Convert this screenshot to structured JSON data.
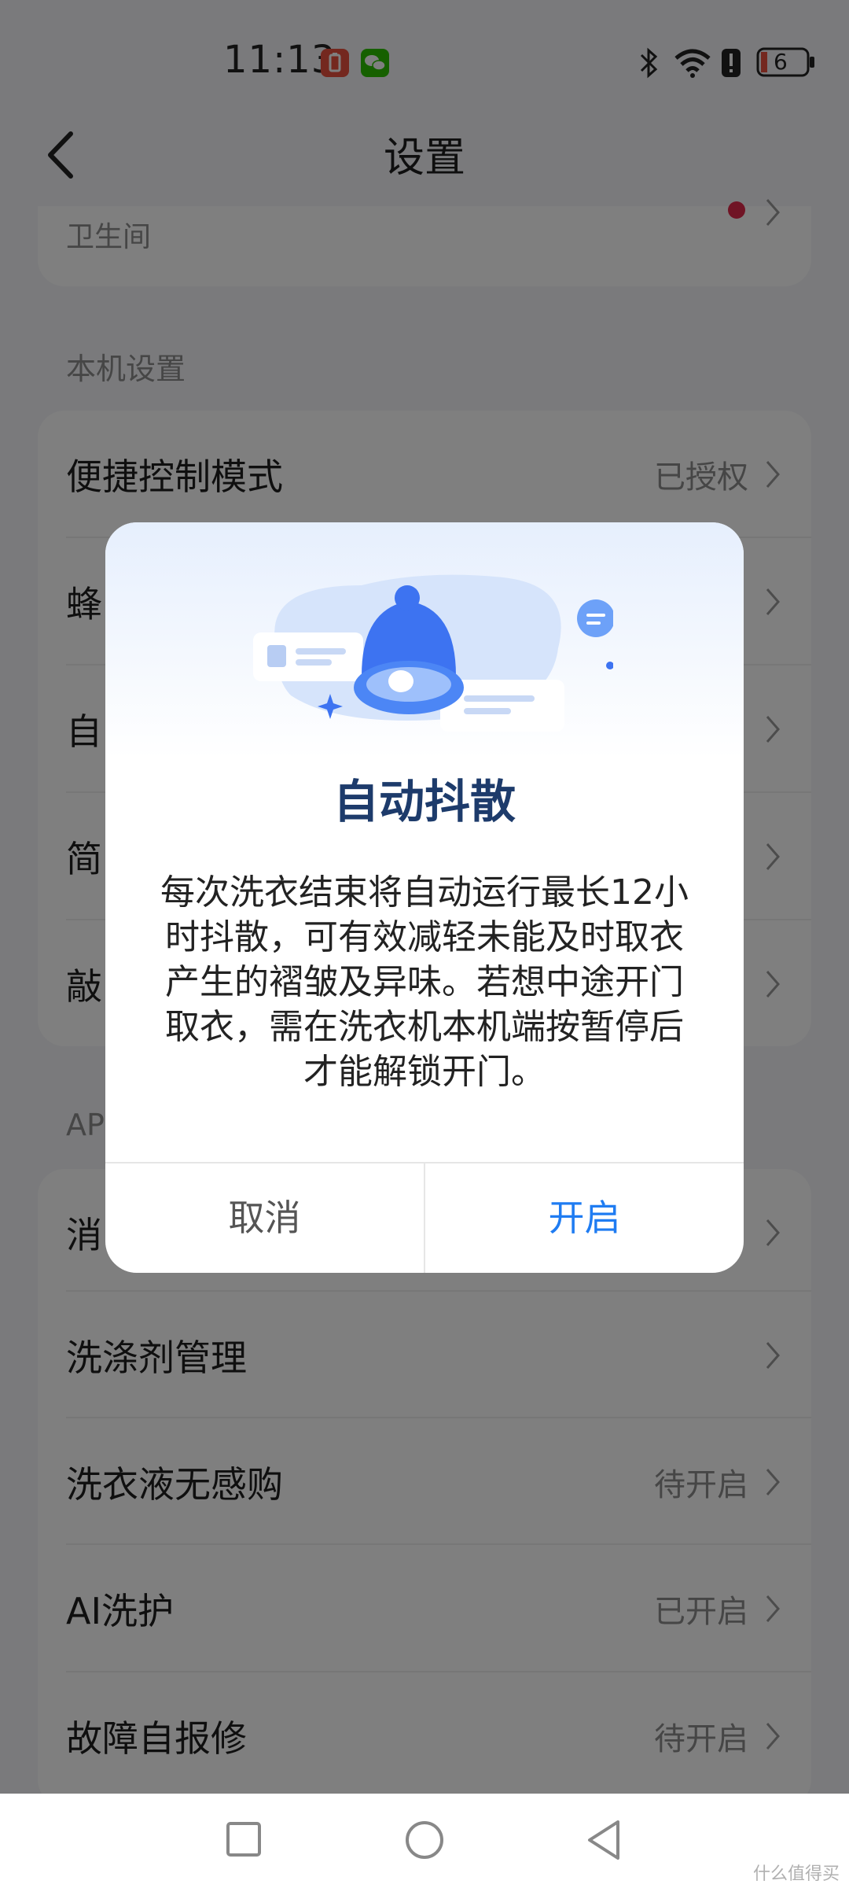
{
  "status_bar": {
    "time": "11:13",
    "battery_level": "6",
    "icons": [
      "battery-saver-icon",
      "wechat-icon",
      "bluetooth-icon",
      "wifi-icon",
      "alert-icon",
      "battery-icon"
    ]
  },
  "header": {
    "title": "设置"
  },
  "top_card": {
    "partial_label": "卫生间"
  },
  "section_local": {
    "title": "本机设置",
    "items": [
      {
        "label": "便捷控制模式",
        "value": "已授权"
      },
      {
        "label": "蜂",
        "value": ""
      },
      {
        "label": "自",
        "value": ""
      },
      {
        "label": "简",
        "value": ""
      },
      {
        "label": "敲",
        "value": ""
      }
    ]
  },
  "section_app": {
    "title": "AP",
    "items": [
      {
        "label": "消",
        "value": ""
      },
      {
        "label": "洗涤剂管理",
        "value": ""
      },
      {
        "label": "洗衣液无感购",
        "value": "待开启"
      },
      {
        "label": "AI洗护",
        "value": "已开启"
      },
      {
        "label": "故障自报修",
        "value": "待开启"
      }
    ]
  },
  "dialog": {
    "title": "自动抖散",
    "body": "每次洗衣结束将自动运行最长12小时抖散，可有效减轻未能及时取衣产生的褶皱及异味。若想中途开门取衣，需在洗衣机本机端按暂停后才能解锁开门。",
    "cancel_label": "取消",
    "confirm_label": "开启",
    "illustration": "bell-icon"
  },
  "nav_bar": {
    "icons": [
      "recent-apps-icon",
      "home-icon",
      "back-nav-icon"
    ]
  },
  "watermark": "什么值得买",
  "colors": {
    "accent": "#1f7cf2",
    "dialog_title": "#1d3b6b",
    "overlay": "rgba(0,0,0,0.5)"
  }
}
